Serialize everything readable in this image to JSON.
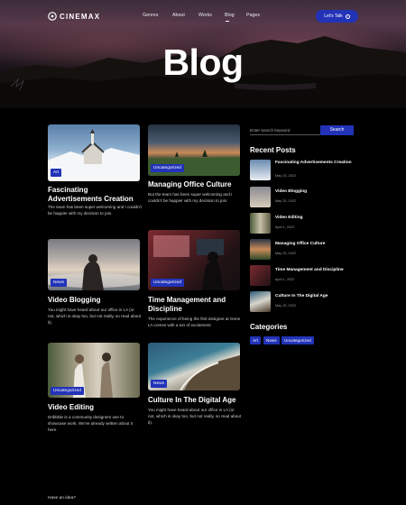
{
  "brand": {
    "name": "CINEMAX"
  },
  "nav": {
    "items": [
      "Genres",
      "About",
      "Works",
      "Blog",
      "Pages"
    ],
    "active_index": 3,
    "cta_label": "Let's Talk",
    "cta_icon": "arrow-right-icon"
  },
  "hero": {
    "title": "Blog"
  },
  "posts": [
    {
      "category": "Art",
      "title": "Fascinating Advertisements Creation",
      "excerpt": "The team has been super welcoming and I couldn't be happier with my decision to join."
    },
    {
      "category": "Uncategorized",
      "title": "Managing Office Culture",
      "excerpt": "But the team has been super welcoming and I couldn't be happier with my decision to join."
    },
    {
      "category": "News",
      "title": "Video Blogging",
      "excerpt": "You might have heard about our office in LA (or not, which is okay too, but not really, so read about it)."
    },
    {
      "category": "Uncategorized",
      "title": "Time Management and Discipline",
      "excerpt": "The experience of being the first designer at Gene LA comes with a ton of excitement"
    },
    {
      "category": "Uncategorized",
      "title": "Video Editing",
      "excerpt": "Dribbble is a community designers use to showcase work. We've already written about it here."
    },
    {
      "category": "News",
      "title": "Culture In The Digital Age",
      "excerpt": "You might have heard about our office in LA (or not, which is okay too, but not really, so read about it)."
    }
  ],
  "sidebar": {
    "search_placeholder": "Enter search keyword",
    "search_button": "Search",
    "recent_heading": "Recent Posts",
    "recent": [
      {
        "title": "Fascinating Advertisements Creation",
        "date": "May 25, 2022"
      },
      {
        "title": "Video Blogging",
        "date": "May 25, 2022"
      },
      {
        "title": "Video Editing",
        "date": "April 1, 2022"
      },
      {
        "title": "Managing Office Culture",
        "date": "May 25, 2022"
      },
      {
        "title": "Time Management and Discipline",
        "date": "April 1, 2022"
      },
      {
        "title": "Culture In The Digital Age",
        "date": "May 25, 2022"
      }
    ],
    "categories_heading": "Categories",
    "categories": [
      "Art",
      "News",
      "Uncategorized"
    ]
  },
  "footer": {
    "question": "Have an idea?"
  },
  "colors": {
    "accent": "#2233b8",
    "background": "#000000"
  }
}
